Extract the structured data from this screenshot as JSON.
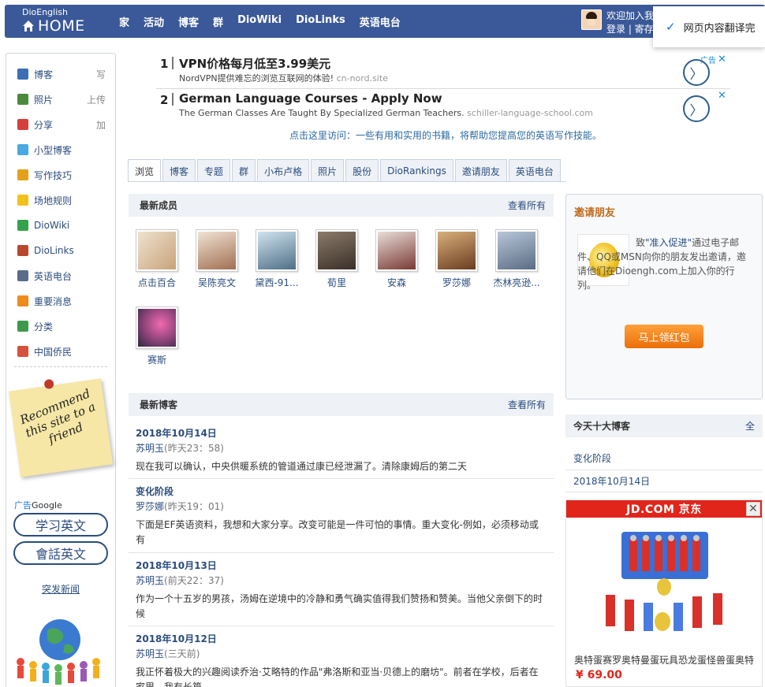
{
  "topbar": {
    "logo_small": "DioEnglish",
    "logo_home": "HOME",
    "nav": [
      "家",
      "活动",
      "博客",
      "群",
      "DioWiki",
      "DioLinks",
      "英语电台"
    ],
    "welcome": "欢迎加入我",
    "login_links": "登录 | 寄存"
  },
  "translate_popup": {
    "text": "网页内容翻译完"
  },
  "sidebar": {
    "items": [
      {
        "label": "博客",
        "extra": "写",
        "icon": "blog-icon",
        "color": "#3a6fb5"
      },
      {
        "label": "照片",
        "extra": "上传",
        "icon": "photo-icon",
        "color": "#4b8a3c"
      },
      {
        "label": "分享",
        "extra": "加",
        "icon": "heart-share-icon",
        "color": "#d6403a"
      },
      {
        "label": "小型博客",
        "extra": "",
        "icon": "chat-bubble-icon",
        "color": "#49a9e0"
      },
      {
        "label": "写作技巧",
        "extra": "",
        "icon": "gear-icon",
        "color": "#e3a11b"
      },
      {
        "label": "场地规则",
        "extra": "",
        "icon": "warning-icon",
        "color": "#f1c21b"
      },
      {
        "label": "DioWiki",
        "extra": "",
        "icon": "globe-icon",
        "color": "#33a34b"
      },
      {
        "label": "DioLinks",
        "extra": "",
        "icon": "house-icon",
        "color": "#b8472c"
      },
      {
        "label": "英语电台",
        "extra": "",
        "icon": "radio-icon",
        "color": "#5a6c8a"
      },
      {
        "label": "重要消息",
        "extra": "",
        "icon": "news-icon",
        "color": "#ef8a1d"
      },
      {
        "label": "分类",
        "extra": "",
        "icon": "share-icon",
        "color": "#3d9a4a"
      },
      {
        "label": "中国侨民",
        "extra": "",
        "icon": "puzzle-icon",
        "color": "#d7523c"
      }
    ],
    "note_text": "Recommend this site to a friend",
    "ad_label": "广告",
    "ad_google": "Google",
    "pill1": "学习英文",
    "pill2": "會話英文",
    "news_link": "突发新闻"
  },
  "ads": [
    {
      "num": "1",
      "title": "VPN价格每月低至3.99美元",
      "desc": "NordVPN提供难忘的浏览互联网的体验!",
      "url": "cn-nord.site",
      "badge": "广告"
    },
    {
      "num": "2",
      "title": "German Language Courses - Apply Now",
      "desc": "The German Classes Are Taught By Specialized German Teachers.",
      "url": "schiller-language-school.com"
    }
  ],
  "info_link": "点击这里访问：一些有用和实用的书籍，将帮助您提高您的英语写作技能。",
  "tabs": [
    "浏览",
    "博客",
    "专题",
    "群",
    "小布卢格",
    "照片",
    "股份",
    "DioRankings",
    "邀请朋友",
    "英语电台"
  ],
  "members_panel": {
    "title": "最新成员",
    "more": "查看所有",
    "members": [
      "点击百合",
      "吴陈亮文",
      "黛西-91...",
      "荀里",
      "安森",
      "罗莎娜",
      "杰林亮逊...",
      "赛斯"
    ]
  },
  "blogs_panel": {
    "title": "最新博客",
    "more": "查看所有",
    "posts": [
      {
        "title": "2018年10月14日",
        "author": "苏明玉",
        "time": "(昨天23：58)",
        "body": "现在我可以确认，中央供暖系统的管道通过康已经泄漏了。清除康姆后的第二天"
      },
      {
        "title": "变化阶段",
        "author": "罗莎娜",
        "time": "(昨天19：01)",
        "body": "下面是EF英语资料，我想和大家分享。改变可能是一件可怕的事情。重大变化-例如，必须移动或有"
      },
      {
        "title": "2018年10月13日",
        "author": "苏明玉",
        "time": "(前天22：37)",
        "body": "作为一个十五岁的男孩，汤姆在逆境中的冷静和勇气确实值得我们赞扬和赞美。当他父亲倒下的时候"
      },
      {
        "title": "2018年10月12日",
        "author": "苏明玉",
        "time": "(三天前)",
        "body": "我正怀着极大的兴趣阅读乔治·艾略特的作品\"弗洛斯和亚当·贝德上的磨坊\"。前者在学校，后者在家里，我有长篇"
      }
    ]
  },
  "invite": {
    "title": "邀请朋友",
    "text_pre": "致",
    "link": "\"准入促进\"",
    "text_post": "通过电子邮件、QQ或MSN向你的朋友发出邀请，邀请他们在Dioengh.com上加入你的行列。",
    "button": "马上领红包"
  },
  "top10": {
    "title": "今天十大博客",
    "more": "全",
    "items": [
      "变化阶段",
      "2018年10月14日"
    ]
  },
  "jd_ad": {
    "brand": "JD.COM 京东",
    "title": "奥特蛋赛罗奥特曼蛋玩具恐龙蛋怪兽蛋奥特",
    "price": "¥ 69.00"
  }
}
